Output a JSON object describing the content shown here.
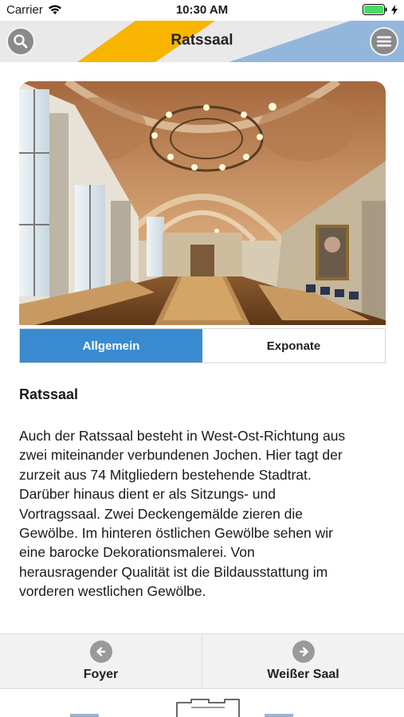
{
  "status_bar": {
    "carrier": "Carrier",
    "time": "10:30 AM"
  },
  "header": {
    "title": "Ratssaal",
    "search_icon": "search-icon",
    "menu_icon": "hamburger-menu-icon",
    "accent_yellow": "#f7b500",
    "accent_blue": "#93b6dc"
  },
  "image": {
    "description_icon": "photo"
  },
  "tabs": [
    {
      "label": "Allgemein",
      "active": true
    },
    {
      "label": "Exponate",
      "active": false
    }
  ],
  "content": {
    "title": "Ratssaal",
    "lines": [
      "Auch der Ratssaal besteht in West-Ost-Richtung aus",
      "zwei miteinander verbundenen Jochen. Hier tagt der",
      "zurzeit aus 74 Mitgliedern bestehende Stadtrat.",
      "Darüber hinaus dient er als Sitzungs- und",
      "Vortragssaal. Zwei Deckengemälde zieren die",
      "Gewölbe. Im hinteren östlichen Gewölbe sehen wir",
      "eine barocke Dekorationsmalerei. Von",
      "herausragender Qualität ist die Bildausstattung im",
      "vorderen westlichen Gewölbe."
    ]
  },
  "bottom_nav": {
    "prev_label": "Foyer",
    "next_label": "Weißer Saal"
  },
  "colors": {
    "tab_active": "#3a8ad0",
    "nav_bg": "#e9e9e9"
  }
}
